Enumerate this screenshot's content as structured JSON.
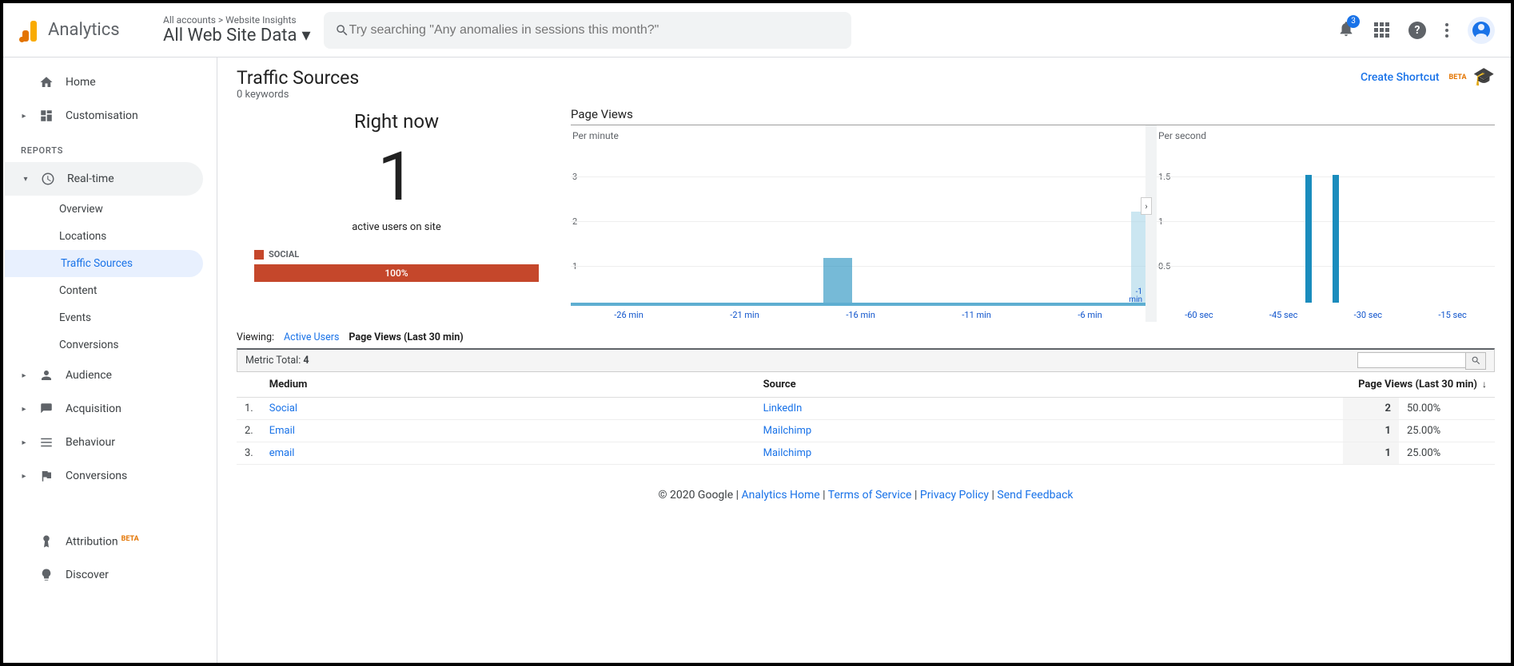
{
  "header": {
    "product": "Analytics",
    "breadcrumb": "All accounts > Website Insights",
    "account_selector": "All Web Site Data",
    "search_placeholder": "Try searching \"Any anomalies in sessions this month?\"",
    "notif_count": "3"
  },
  "sidebar": {
    "home": "Home",
    "customisation": "Customisation",
    "section_reports": "REPORTS",
    "realtime": "Real-time",
    "realtime_items": [
      "Overview",
      "Locations",
      "Traffic Sources",
      "Content",
      "Events",
      "Conversions"
    ],
    "audience": "Audience",
    "acquisition": "Acquisition",
    "behaviour": "Behaviour",
    "conversions": "Conversions",
    "attribution": "Attribution",
    "attribution_badge": "BETA",
    "discover": "Discover"
  },
  "page": {
    "title": "Traffic Sources",
    "subtitle": "0 keywords",
    "shortcut": "Create Shortcut",
    "shortcut_badge": "BETA"
  },
  "realtime": {
    "heading": "Right now",
    "value": "1",
    "caption": "active users on site",
    "legend": "SOCIAL",
    "bar_pct": "100%"
  },
  "charts": {
    "title": "Page Views",
    "per_minute": "Per minute",
    "per_second": "Per second"
  },
  "chart_data": [
    {
      "type": "bar",
      "title": "Per minute",
      "xlabel": "minute",
      "ylabel": "page views",
      "ylim": [
        0,
        3
      ],
      "y_ticks": [
        1,
        2,
        3
      ],
      "categories": [
        "-26 min",
        "-21 min",
        "-16 min",
        "-11 min",
        "-6 min",
        "-1 min"
      ],
      "bars": [
        {
          "minute": -16,
          "value": 1
        },
        {
          "minute": -1,
          "value": 2.2
        }
      ]
    },
    {
      "type": "bar",
      "title": "Per second",
      "xlabel": "second",
      "ylabel": "page views",
      "ylim": [
        0,
        1.5
      ],
      "y_ticks": [
        0.5,
        1,
        1.5
      ],
      "categories": [
        "-60 sec",
        "-45 sec",
        "-30 sec",
        "-15 sec"
      ],
      "bars": [
        {
          "second": -32,
          "value": 1.5
        },
        {
          "second": -30,
          "value": 1.5
        }
      ]
    }
  ],
  "viewing": {
    "label": "Viewing:",
    "active_users": "Active Users",
    "pageviews": "Page Views (Last 30 min)"
  },
  "metric": {
    "label": "Metric Total:",
    "value": "4"
  },
  "table": {
    "cols": {
      "medium": "Medium",
      "source": "Source",
      "metric": "Page Views (Last 30 min)"
    },
    "rows": [
      {
        "idx": "1.",
        "medium": "Social",
        "source": "LinkedIn",
        "count": "2",
        "pct": "50.00%"
      },
      {
        "idx": "2.",
        "medium": "Email",
        "source": "Mailchimp",
        "count": "1",
        "pct": "25.00%"
      },
      {
        "idx": "3.",
        "medium": "email",
        "source": "Mailchimp",
        "count": "1",
        "pct": "25.00%"
      }
    ]
  },
  "footer": {
    "copyright": "© 2020 Google",
    "links": [
      "Analytics Home",
      "Terms of Service",
      "Privacy Policy",
      "Send Feedback"
    ]
  }
}
